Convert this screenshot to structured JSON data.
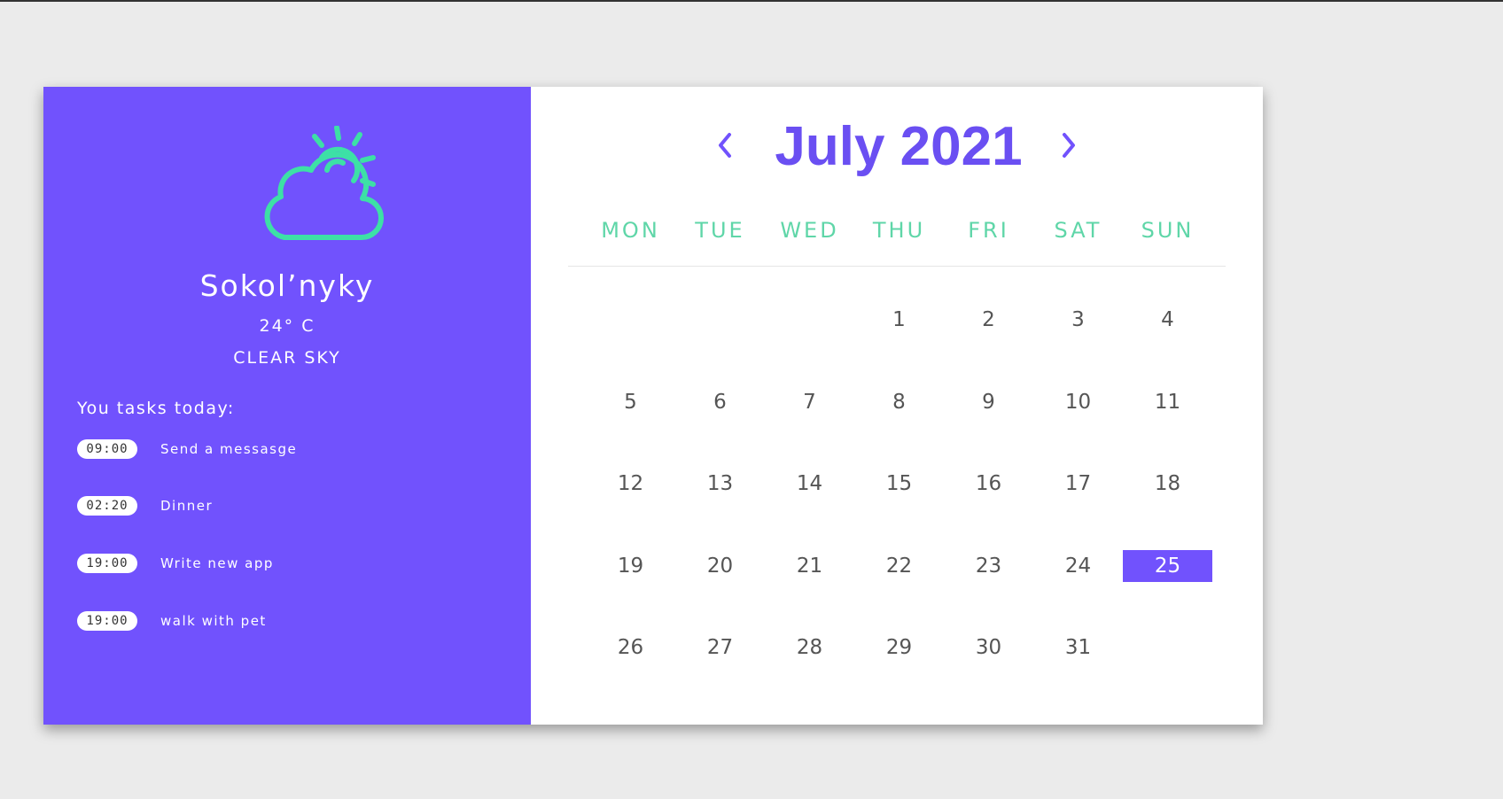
{
  "weather": {
    "city": "Sokol’nyky",
    "temperature": "24° C",
    "condition": "CLEAR SKY",
    "icon": "partly-cloudy-icon",
    "icon_color": "#3de0a6"
  },
  "tasks": {
    "title": "You tasks today:",
    "items": [
      {
        "time": "09:00",
        "text": "Send a messasge"
      },
      {
        "time": "02:20",
        "text": "Dinner"
      },
      {
        "time": "19:00",
        "text": "Write new app"
      },
      {
        "time": "19:00",
        "text": "walk with pet"
      }
    ]
  },
  "calendar": {
    "month_title": "July 2021",
    "prev_icon": "chevron-left-icon",
    "next_icon": "chevron-right-icon",
    "weekdays": [
      "MON",
      "TUE",
      "WED",
      "THU",
      "FRI",
      "SAT",
      "SUN"
    ],
    "weeks": [
      [
        "",
        "",
        "",
        "1",
        "2",
        "3",
        "4"
      ],
      [
        "5",
        "6",
        "7",
        "8",
        "9",
        "10",
        "11"
      ],
      [
        "12",
        "13",
        "14",
        "15",
        "16",
        "17",
        "18"
      ],
      [
        "19",
        "20",
        "21",
        "22",
        "23",
        "24",
        "25"
      ],
      [
        "26",
        "27",
        "28",
        "29",
        "30",
        "31",
        ""
      ]
    ],
    "selected_day": "25"
  },
  "colors": {
    "accent": "#7152fd",
    "weekday_text": "#5fd6a8",
    "page_background": "#ebebeb"
  }
}
